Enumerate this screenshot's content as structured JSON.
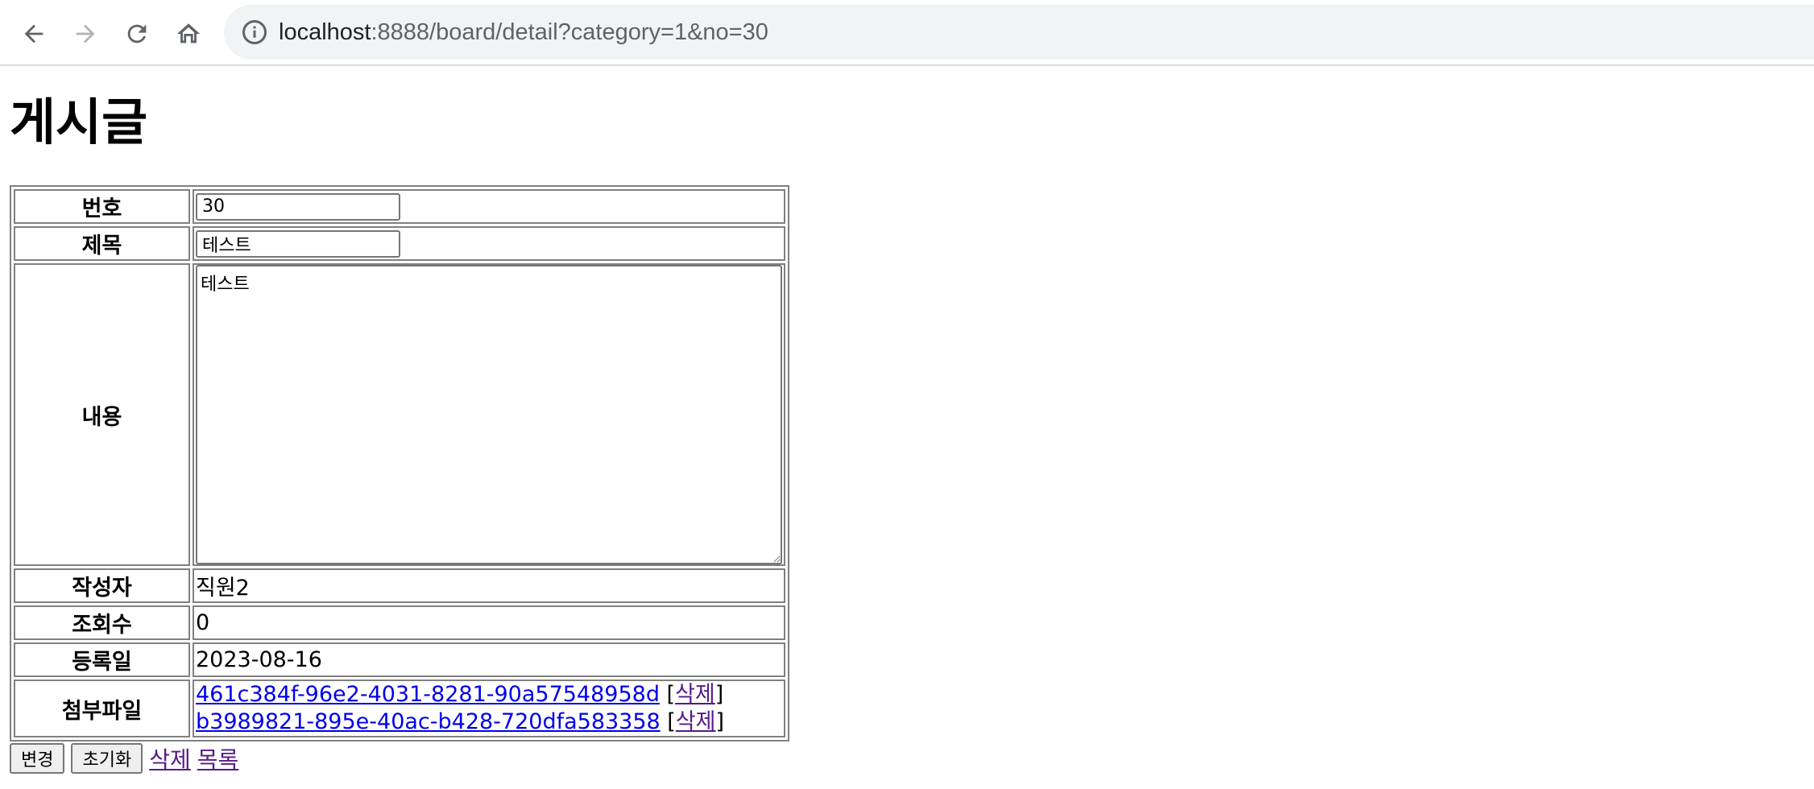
{
  "browser": {
    "url_host": "localhost",
    "url_rest": ":8888/board/detail?category=1&no=30"
  },
  "page": {
    "title": "게시글"
  },
  "form": {
    "no_label": "번호",
    "no_value": "30",
    "subject_label": "제목",
    "subject_value": "테스트",
    "content_label": "내용",
    "content_value": "테스트",
    "writer_label": "작성자",
    "writer_value": "직원2",
    "views_label": "조회수",
    "views_value": "0",
    "regdate_label": "등록일",
    "regdate_value": "2023-08-16",
    "files_label": "첨부파일",
    "files": [
      {
        "name": "461c384f-96e2-4031-8281-90a57548958d",
        "delete_label": "삭제"
      },
      {
        "name": "b3989821-895e-40ac-b428-720dfa583358",
        "delete_label": "삭제"
      }
    ]
  },
  "actions": {
    "update_label": "변경",
    "reset_label": "초기화",
    "delete_label": "삭제",
    "list_label": "목록"
  }
}
